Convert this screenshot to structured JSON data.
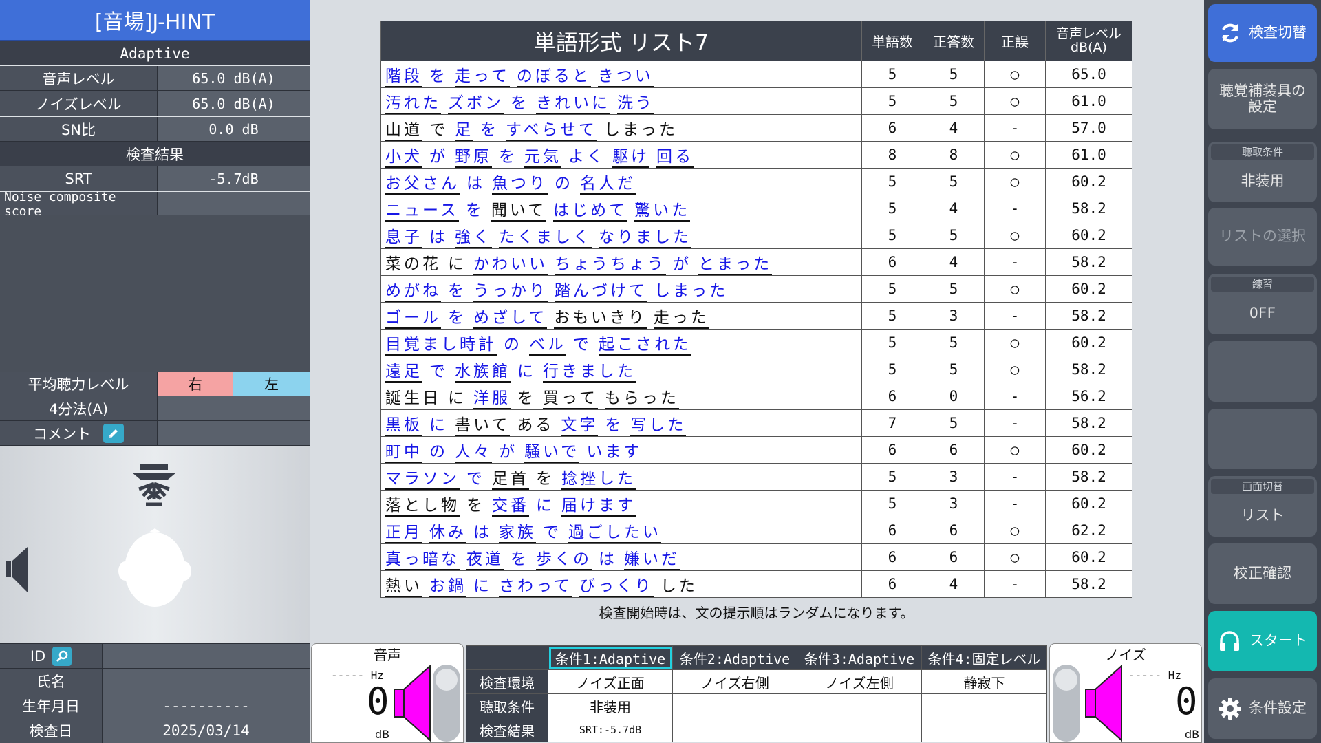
{
  "left": {
    "app_title": "[音場]J-HINT",
    "mode": "Adaptive",
    "rows": [
      {
        "label": "音声レベル",
        "value": "65.0 dB(A)"
      },
      {
        "label": "ノイズレベル",
        "value": "65.0 dB(A)"
      },
      {
        "label": "SN比",
        "value": "0.0 dB"
      }
    ],
    "result_header": "検査結果",
    "result_rows": [
      {
        "label": "SRT",
        "value": "-5.7dB"
      },
      {
        "label": "Noise composite score",
        "value": ""
      }
    ],
    "avg_level_label": "平均聴力レベル",
    "right_ear": "右",
    "left_ear": "左",
    "method_label": "4分法(A)",
    "comment_label": "コメント",
    "info": [
      {
        "label": "ID",
        "value": ""
      },
      {
        "label": "氏名",
        "value": ""
      },
      {
        "label": "生年月日",
        "value": "----------"
      },
      {
        "label": "検査日",
        "value": "2025/03/14"
      }
    ]
  },
  "table": {
    "title": "単語形式 リスト7",
    "col_words": "単語数",
    "col_correct": "正答数",
    "col_judge": "正誤",
    "col_level": "音声レベル dB(A)",
    "rows": [
      {
        "t": [
          [
            "w",
            "階段"
          ],
          [
            "p",
            "を"
          ],
          [
            "w",
            "走って"
          ],
          [
            "w",
            "のぼると"
          ],
          [
            "w",
            "きつい"
          ]
        ],
        "words": "5",
        "correct": "5",
        "judge": "○",
        "level": "65.0"
      },
      {
        "t": [
          [
            "w",
            "汚れた"
          ],
          [
            "w",
            "ズボン"
          ],
          [
            "p",
            "を"
          ],
          [
            "w",
            "きれいに"
          ],
          [
            "w",
            "洗う"
          ]
        ],
        "words": "5",
        "correct": "5",
        "judge": "○",
        "level": "61.0"
      },
      {
        "t": [
          [
            "b",
            "山道"
          ],
          [
            "k",
            "で"
          ],
          [
            "w",
            "足"
          ],
          [
            "p",
            "を"
          ],
          [
            "w",
            "すべらせて"
          ],
          [
            "k",
            "しまった"
          ]
        ],
        "words": "6",
        "correct": "4",
        "judge": "-",
        "level": "57.0"
      },
      {
        "t": [
          [
            "w",
            "小犬"
          ],
          [
            "p",
            "が"
          ],
          [
            "w",
            "野原"
          ],
          [
            "p",
            "を"
          ],
          [
            "w",
            "元気"
          ],
          [
            "p",
            "よく"
          ],
          [
            "w",
            "駆け"
          ],
          [
            "w",
            "回る"
          ]
        ],
        "words": "8",
        "correct": "8",
        "judge": "○",
        "level": "61.0"
      },
      {
        "t": [
          [
            "w",
            "お父さん"
          ],
          [
            "p",
            "は"
          ],
          [
            "w",
            "魚つり"
          ],
          [
            "p",
            "の"
          ],
          [
            "w",
            "名人だ"
          ]
        ],
        "words": "5",
        "correct": "5",
        "judge": "○",
        "level": "60.2"
      },
      {
        "t": [
          [
            "w",
            "ニュース"
          ],
          [
            "p",
            "を"
          ],
          [
            "b",
            "聞いて"
          ],
          [
            "w",
            "はじめて"
          ],
          [
            "w",
            "驚いた"
          ]
        ],
        "words": "5",
        "correct": "4",
        "judge": "-",
        "level": "58.2"
      },
      {
        "t": [
          [
            "w",
            "息子"
          ],
          [
            "p",
            "は"
          ],
          [
            "w",
            "強く"
          ],
          [
            "w",
            "たくましく"
          ],
          [
            "w",
            "なりました"
          ]
        ],
        "words": "5",
        "correct": "5",
        "judge": "○",
        "level": "60.2"
      },
      {
        "t": [
          [
            "k",
            "菜の花"
          ],
          [
            "k",
            "に"
          ],
          [
            "w",
            "かわいい"
          ],
          [
            "w",
            "ちょうちょう"
          ],
          [
            "p",
            "が"
          ],
          [
            "w",
            "とまった"
          ]
        ],
        "words": "6",
        "correct": "4",
        "judge": "-",
        "level": "58.2"
      },
      {
        "t": [
          [
            "w",
            "めがね"
          ],
          [
            "p",
            "を"
          ],
          [
            "w",
            "うっかり"
          ],
          [
            "w",
            "踏んづけて"
          ],
          [
            "p",
            "しまった"
          ]
        ],
        "words": "5",
        "correct": "5",
        "judge": "○",
        "level": "60.2"
      },
      {
        "t": [
          [
            "w",
            "ゴール"
          ],
          [
            "p",
            "を"
          ],
          [
            "w",
            "めざして"
          ],
          [
            "b",
            "おもいきり"
          ],
          [
            "b",
            "走った"
          ]
        ],
        "words": "5",
        "correct": "3",
        "judge": "-",
        "level": "58.2"
      },
      {
        "t": [
          [
            "w",
            "目覚まし時計"
          ],
          [
            "p",
            "の"
          ],
          [
            "w",
            "ベル"
          ],
          [
            "p",
            "で"
          ],
          [
            "w",
            "起こされた"
          ]
        ],
        "words": "5",
        "correct": "5",
        "judge": "○",
        "level": "60.2"
      },
      {
        "t": [
          [
            "w",
            "遠足"
          ],
          [
            "p",
            "で"
          ],
          [
            "w",
            "水族館"
          ],
          [
            "p",
            "に"
          ],
          [
            "w",
            "行きました"
          ]
        ],
        "words": "5",
        "correct": "5",
        "judge": "○",
        "level": "58.2"
      },
      {
        "t": [
          [
            "k",
            "誕生日"
          ],
          [
            "k",
            "に"
          ],
          [
            "w",
            "洋服"
          ],
          [
            "k",
            "を"
          ],
          [
            "b",
            "買って"
          ],
          [
            "b",
            "もらった"
          ]
        ],
        "words": "6",
        "correct": "0",
        "judge": "-",
        "level": "56.2"
      },
      {
        "t": [
          [
            "w",
            "黒板"
          ],
          [
            "p",
            "に"
          ],
          [
            "b",
            "書いて"
          ],
          [
            "k",
            "ある"
          ],
          [
            "w",
            "文字"
          ],
          [
            "p",
            "を"
          ],
          [
            "w",
            "写した"
          ]
        ],
        "words": "7",
        "correct": "5",
        "judge": "-",
        "level": "58.2"
      },
      {
        "t": [
          [
            "w",
            "町中"
          ],
          [
            "p",
            "の"
          ],
          [
            "w",
            "人々"
          ],
          [
            "p",
            "が"
          ],
          [
            "w",
            "騒いで"
          ],
          [
            "p",
            "います"
          ]
        ],
        "words": "6",
        "correct": "6",
        "judge": "○",
        "level": "60.2"
      },
      {
        "t": [
          [
            "w",
            "マラソン"
          ],
          [
            "p",
            "で"
          ],
          [
            "b",
            "足首"
          ],
          [
            "k",
            "を"
          ],
          [
            "w",
            "捻挫した"
          ]
        ],
        "words": "5",
        "correct": "3",
        "judge": "-",
        "level": "58.2"
      },
      {
        "t": [
          [
            "b",
            "落とし物"
          ],
          [
            "k",
            "を"
          ],
          [
            "w",
            "交番"
          ],
          [
            "p",
            "に"
          ],
          [
            "w",
            "届けます"
          ]
        ],
        "words": "5",
        "correct": "3",
        "judge": "-",
        "level": "60.2"
      },
      {
        "t": [
          [
            "w",
            "正月"
          ],
          [
            "w",
            "休み"
          ],
          [
            "p",
            "は"
          ],
          [
            "w",
            "家族"
          ],
          [
            "p",
            "で"
          ],
          [
            "w",
            "過ごしたい"
          ]
        ],
        "words": "6",
        "correct": "6",
        "judge": "○",
        "level": "62.2"
      },
      {
        "t": [
          [
            "w",
            "真っ暗な"
          ],
          [
            "w",
            "夜道"
          ],
          [
            "p",
            "を"
          ],
          [
            "w",
            "歩くの"
          ],
          [
            "p",
            "は"
          ],
          [
            "w",
            "嫌いだ"
          ]
        ],
        "words": "6",
        "correct": "6",
        "judge": "○",
        "level": "60.2"
      },
      {
        "t": [
          [
            "b",
            "熱い"
          ],
          [
            "w",
            "お鍋"
          ],
          [
            "p",
            "に"
          ],
          [
            "w",
            "さわって"
          ],
          [
            "w",
            "びっくり"
          ],
          [
            "k",
            "した"
          ]
        ],
        "words": "6",
        "correct": "4",
        "judge": "-",
        "level": "58.2"
      }
    ],
    "note": "検査開始時は、文の提示順はランダムになります。"
  },
  "voice_meter": {
    "title": "音声",
    "hz": "----- Hz",
    "value": "0",
    "unit": "dB"
  },
  "noise_meter": {
    "title": "ノイズ",
    "hz": "----- Hz",
    "value": "0",
    "unit": "dB"
  },
  "conditions": {
    "headers": [
      "条件1:Adaptive",
      "条件2:Adaptive",
      "条件3:Adaptive",
      "条件4:固定レベル"
    ],
    "row_labels": [
      "検査環境",
      "聴取条件",
      "検査結果"
    ],
    "env": [
      "ノイズ正面",
      "ノイズ右側",
      "ノイズ左側",
      "静寂下"
    ],
    "listen": [
      "非装用",
      "",
      "",
      ""
    ],
    "result": [
      "SRT:-5.7dB",
      "",
      "",
      ""
    ]
  },
  "right": {
    "switch_test": "検査切替",
    "hearing_aid": "聴覚補装具の設定",
    "listen_cap": "聴取条件",
    "listen_val": "非装用",
    "list_select": "リストの選択",
    "practice_cap": "練習",
    "practice_val": "OFF",
    "screen_cap": "画面切替",
    "screen_val": "リスト",
    "calib": "校正確認",
    "start": "スタート",
    "cond_set": "条件設定"
  },
  "colors": {
    "accent_blue": "#3f6fd8",
    "teal": "#14b8b0",
    "right_ear": "#f5a3a3",
    "left_ear": "#8cd3ee",
    "speaker": "#ff00ff"
  }
}
